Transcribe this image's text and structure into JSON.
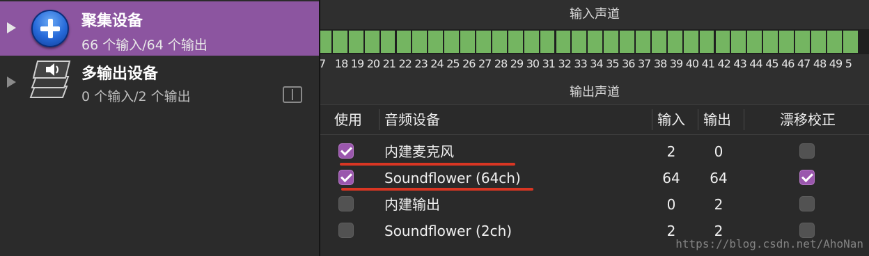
{
  "sidebar": {
    "devices": [
      {
        "name": "聚集设备",
        "subtitle": "66 个输入/64 个输出",
        "icon": "aggregate-device-plus-icon",
        "selected": true
      },
      {
        "name": "多输出设备",
        "subtitle": "0 个输入/2 个输出",
        "icon": "multi-output-device-icon",
        "selected": false
      }
    ],
    "finder_icon": "finder-icon"
  },
  "panel": {
    "input_channels_title": "输入声道",
    "output_channels_title": "输出声道",
    "channel_numbers": [
      "7",
      "18",
      "19",
      "20",
      "21",
      "22",
      "23",
      "24",
      "25",
      "26",
      "27",
      "28",
      "29",
      "30",
      "31",
      "32",
      "33",
      "34",
      "35",
      "36",
      "37",
      "38",
      "39",
      "40",
      "41",
      "42",
      "43",
      "44",
      "45",
      "46",
      "47",
      "48",
      "49",
      "5"
    ]
  },
  "table": {
    "headers": {
      "use": "使用",
      "device": "音频设备",
      "inputs": "输入",
      "outputs": "输出",
      "drift": "漂移校正"
    },
    "rows": [
      {
        "use": true,
        "device": "内建麦克风",
        "inputs": "2",
        "outputs": "0",
        "drift": false
      },
      {
        "use": true,
        "device": "Soundflower (64ch)",
        "inputs": "64",
        "outputs": "64",
        "drift": true
      },
      {
        "use": false,
        "device": "内建输出",
        "inputs": "0",
        "outputs": "2",
        "drift": false
      },
      {
        "use": false,
        "device": "Soundflower (2ch)",
        "inputs": "2",
        "outputs": "2",
        "drift": false
      }
    ]
  },
  "watermark": "https://blog.csdn.net/AhoNan",
  "colors": {
    "selection": "#8c55a0",
    "checkbox_on": "#9a57ad",
    "channel_active": "#74b561",
    "annotation_red": "#d93623"
  }
}
